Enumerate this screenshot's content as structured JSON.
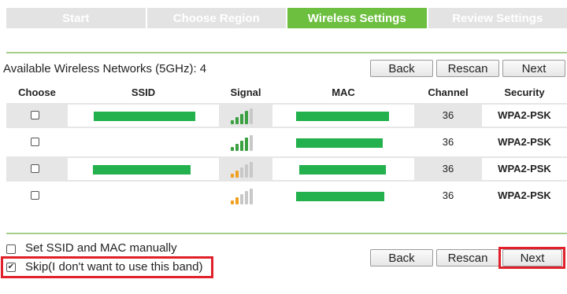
{
  "steps": [
    "Start",
    "Choose Region",
    "Wireless Settings",
    "Review Settings"
  ],
  "active_step": 2,
  "available_label": "Available Wireless Networks (5GHz): 4",
  "top_buttons": {
    "back": "Back",
    "rescan": "Rescan",
    "next": "Next"
  },
  "columns": {
    "choose": "Choose",
    "ssid": "SSID",
    "signal": "Signal",
    "mac": "MAC",
    "channel": "Channel",
    "security": "Security"
  },
  "rows": [
    {
      "channel": "36",
      "security": "WPA2-PSK",
      "signal_level": 4,
      "signal_color": "green",
      "checked": false
    },
    {
      "channel": "36",
      "security": "WPA2-PSK",
      "signal_level": 4,
      "signal_color": "green",
      "checked": false
    },
    {
      "channel": "36",
      "security": "WPA2-PSK",
      "signal_level": 2,
      "signal_color": "orange",
      "checked": false
    },
    {
      "channel": "36",
      "security": "WPA2-PSK",
      "signal_level": 2,
      "signal_color": "orange",
      "checked": false
    }
  ],
  "options": {
    "manual": {
      "label": "Set SSID and MAC manually",
      "checked": false
    },
    "skip": {
      "label": "Skip(I don't want to use this band)",
      "checked": true
    }
  },
  "bottom_buttons": {
    "back": "Back",
    "rescan": "Rescan",
    "next": "Next"
  },
  "colors": {
    "accent_green": "#6cbf3f",
    "step_inactive": "#e3e3e3",
    "signal_green": "#3aa040",
    "signal_orange": "#f0a020",
    "signal_off": "#c8c8c8",
    "highlight_red": "#e0202a",
    "redaction_green": "#22b14c"
  }
}
